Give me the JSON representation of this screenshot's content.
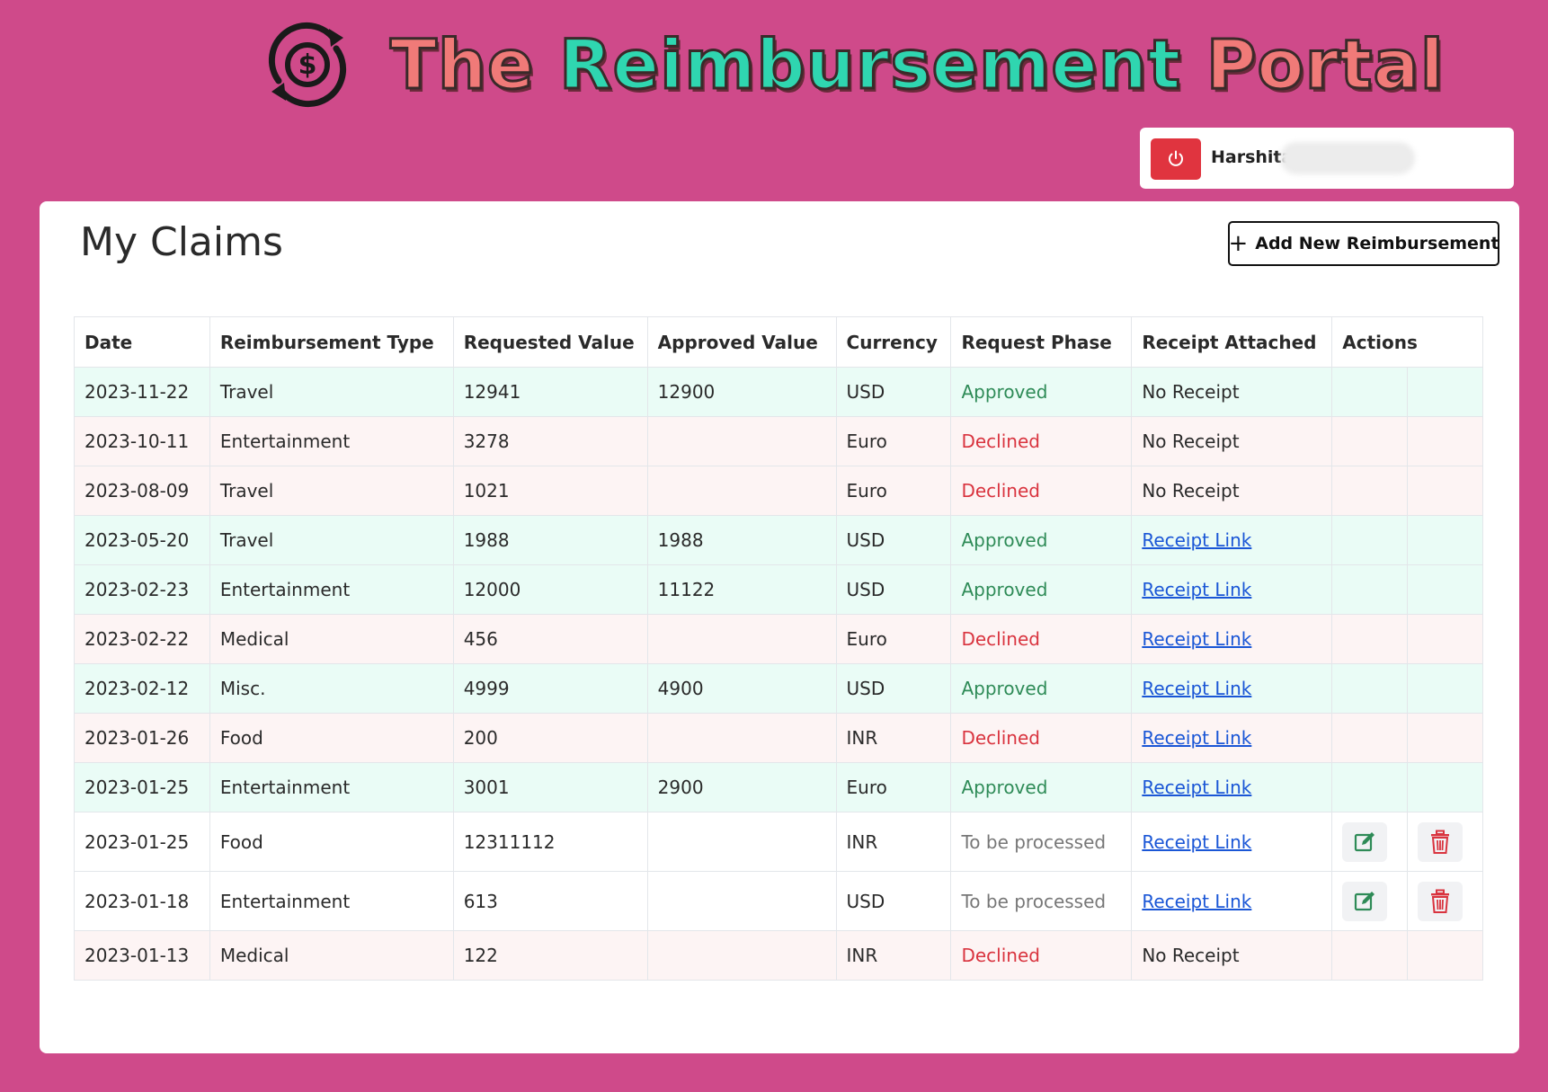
{
  "header": {
    "title_words": [
      "The",
      "Reimbursement",
      "Portal"
    ],
    "logo_icon": "dollar-cycle-icon"
  },
  "user": {
    "name": "Harshita",
    "logout_icon": "power-icon",
    "logout_color": "#e0343f"
  },
  "page": {
    "title": "My Claims",
    "add_button_label": "Add New Reimbursement"
  },
  "colors": {
    "background": "#cf4a8a",
    "approved_row": "#eafcf6",
    "declined_row": "#fdf4f4",
    "approved_text": "#2e8b57",
    "declined_text": "#d9343f",
    "link": "#1a56d6"
  },
  "table": {
    "columns": [
      "Date",
      "Reimbursement Type",
      "Requested Value",
      "Approved Value",
      "Currency",
      "Request Phase",
      "Receipt Attached",
      "Actions"
    ],
    "rows": [
      {
        "date": "2023-11-22",
        "type": "Travel",
        "requested": "12941",
        "approved": "12900",
        "currency": "USD",
        "phase": "Approved",
        "receipt": "No Receipt",
        "has_link": false,
        "editable": false
      },
      {
        "date": "2023-10-11",
        "type": "Entertainment",
        "requested": "3278",
        "approved": "",
        "currency": "Euro",
        "phase": "Declined",
        "receipt": "No Receipt",
        "has_link": false,
        "editable": false
      },
      {
        "date": "2023-08-09",
        "type": "Travel",
        "requested": "1021",
        "approved": "",
        "currency": "Euro",
        "phase": "Declined",
        "receipt": "No Receipt",
        "has_link": false,
        "editable": false
      },
      {
        "date": "2023-05-20",
        "type": "Travel",
        "requested": "1988",
        "approved": "1988",
        "currency": "USD",
        "phase": "Approved",
        "receipt": "Receipt Link",
        "has_link": true,
        "editable": false
      },
      {
        "date": "2023-02-23",
        "type": "Entertainment",
        "requested": "12000",
        "approved": "11122",
        "currency": "USD",
        "phase": "Approved",
        "receipt": "Receipt Link",
        "has_link": true,
        "editable": false
      },
      {
        "date": "2023-02-22",
        "type": "Medical",
        "requested": "456",
        "approved": "",
        "currency": "Euro",
        "phase": "Declined",
        "receipt": "Receipt Link",
        "has_link": true,
        "editable": false
      },
      {
        "date": "2023-02-12",
        "type": "Misc.",
        "requested": "4999",
        "approved": "4900",
        "currency": "USD",
        "phase": "Approved",
        "receipt": "Receipt Link",
        "has_link": true,
        "editable": false
      },
      {
        "date": "2023-01-26",
        "type": "Food",
        "requested": "200",
        "approved": "",
        "currency": "INR",
        "phase": "Declined",
        "receipt": "Receipt Link",
        "has_link": true,
        "editable": false
      },
      {
        "date": "2023-01-25",
        "type": "Entertainment",
        "requested": "3001",
        "approved": "2900",
        "currency": "Euro",
        "phase": "Approved",
        "receipt": "Receipt Link",
        "has_link": true,
        "editable": false
      },
      {
        "date": "2023-01-25",
        "type": "Food",
        "requested": "12311112",
        "approved": "",
        "currency": "INR",
        "phase": "To be processed",
        "receipt": "Receipt Link",
        "has_link": true,
        "editable": true
      },
      {
        "date": "2023-01-18",
        "type": "Entertainment",
        "requested": "613",
        "approved": "",
        "currency": "USD",
        "phase": "To be processed",
        "receipt": "Receipt Link",
        "has_link": true,
        "editable": true
      },
      {
        "date": "2023-01-13",
        "type": "Medical",
        "requested": "122",
        "approved": "",
        "currency": "INR",
        "phase": "Declined",
        "receipt": "No Receipt",
        "has_link": false,
        "editable": false
      }
    ]
  }
}
